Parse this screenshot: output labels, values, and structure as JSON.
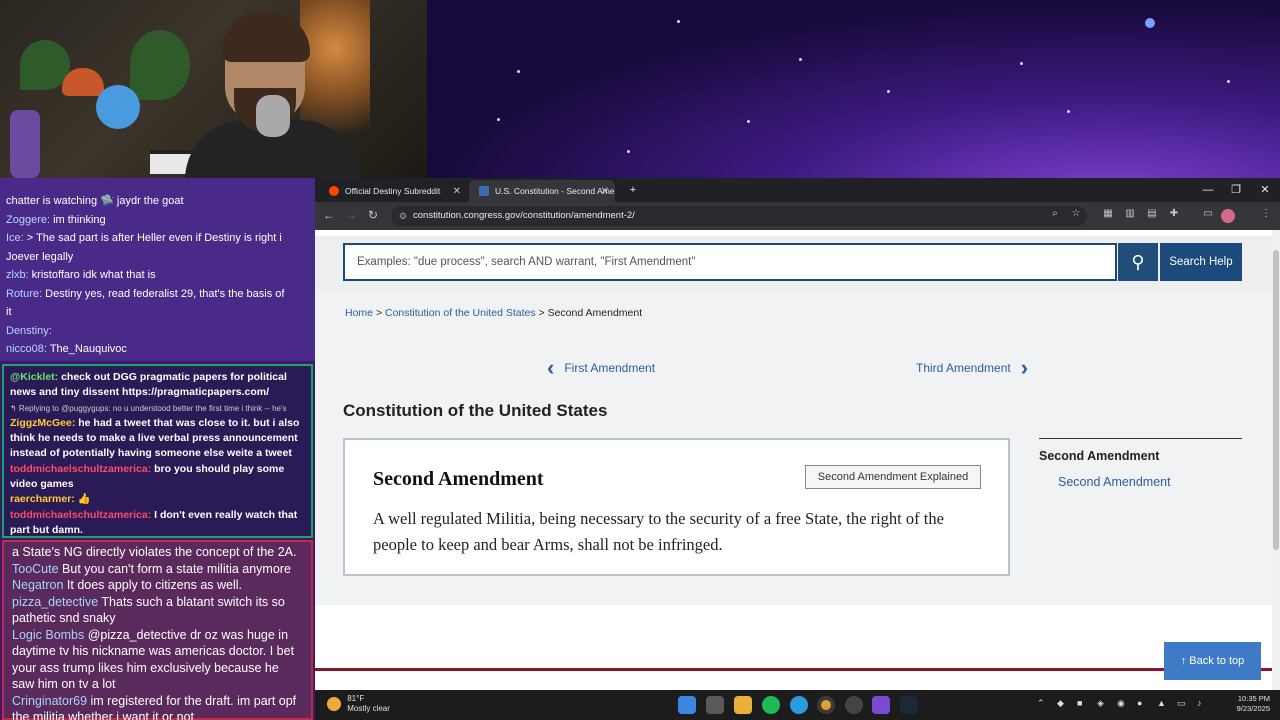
{
  "chat": {
    "top": [
      {
        "user": "",
        "text": "chatter is watching 🛸 jaydr the goat"
      },
      {
        "user": "Zoggere:",
        "text": " im thinking"
      },
      {
        "user": "Ice:",
        "text": " > The sad part is after Heller even if Destiny is right i"
      },
      {
        "user": "",
        "text": "Joever legally"
      },
      {
        "user": "zlxb:",
        "text": " kristoffaro idk what that is"
      },
      {
        "user": "Roture:",
        "text": " Destiny yes, read federalist 29, that's the basis of"
      },
      {
        "user": "",
        "text": "it"
      },
      {
        "user": "Denstiny:",
        "text": ""
      },
      {
        "user": "nicco08:",
        "text": " The_Nauquivoc"
      }
    ],
    "mid": [
      {
        "user": "@Kicklet:",
        "text": " check out DGG pragmatic papers for political news and tiny dissent https://pragmaticpapers.com/",
        "cls": "g"
      },
      {
        "user": "",
        "text": "↰ Replying to @puggygups: no u understood better the first time i think -- he's",
        "cls": "small"
      },
      {
        "user": "ZiggzMcGee:",
        "text": " he had a tweet that was close to it. but i also think he needs to make a live verbal press announcement instead of potentially having someone else weite a tweet",
        "cls": "u"
      },
      {
        "user": "toddmichaelschultzamerica:",
        "text": " bro you should play some video games",
        "cls": "r"
      },
      {
        "user": "raercharmer:",
        "text": " 👍",
        "cls": "u"
      },
      {
        "user": "toddmichaelschultzamerica:",
        "text": " I don't even really watch that part but damn.",
        "cls": "r"
      }
    ],
    "low": [
      {
        "user": "",
        "text": "a State's NG directly violates the concept of the 2A."
      },
      {
        "user": "TooCute",
        "text": " But you can't form a state militia anymore"
      },
      {
        "user": "Negatron",
        "text": " It does apply to citizens as well."
      },
      {
        "user": "pizza_detective",
        "text": " Thats such a blatant switch its so pathetic snd snaky"
      },
      {
        "user": "Logic Bombs",
        "text": " @pizza_detective dr oz was huge in daytime tv his nickname was americas doctor. I bet your ass trump likes him exclusively because he saw him on tv a lot"
      },
      {
        "user": "Cringinator69",
        "text": " im registered for the draft. im part opf the militia whether i want it or not"
      }
    ]
  },
  "browser": {
    "tabs": [
      {
        "label": "Official Destiny Subreddit"
      },
      {
        "label": "U.S. Constitution - Second Ame"
      }
    ],
    "url": "constitution.congress.gov/constitution/amendment-2/"
  },
  "page": {
    "search_placeholder": "Examples: \"due process\", search AND warrant, \"First Amendment\"",
    "search_help": "Search Help",
    "breadcrumb_home": "Home",
    "breadcrumb_const": "Constitution of the United States",
    "breadcrumb_current": "Second Amendment",
    "prev_label": "First Amendment",
    "next_label": "Third Amendment",
    "section_title": "Constitution of the United States",
    "card_title": "Second Amendment",
    "card_button": "Second Amendment Explained",
    "card_text": "A well regulated Militia, being necessary to the security of a free State, the right of the people to keep and bear Arms, shall not be infringed.",
    "side_heading": "Second Amendment",
    "side_link": "Second Amendment",
    "back_to_top": "Back to top"
  },
  "taskbar": {
    "temp": "81°F",
    "weather": "Mostly clear",
    "time": "10:35 PM",
    "date": "9/23/2025"
  }
}
